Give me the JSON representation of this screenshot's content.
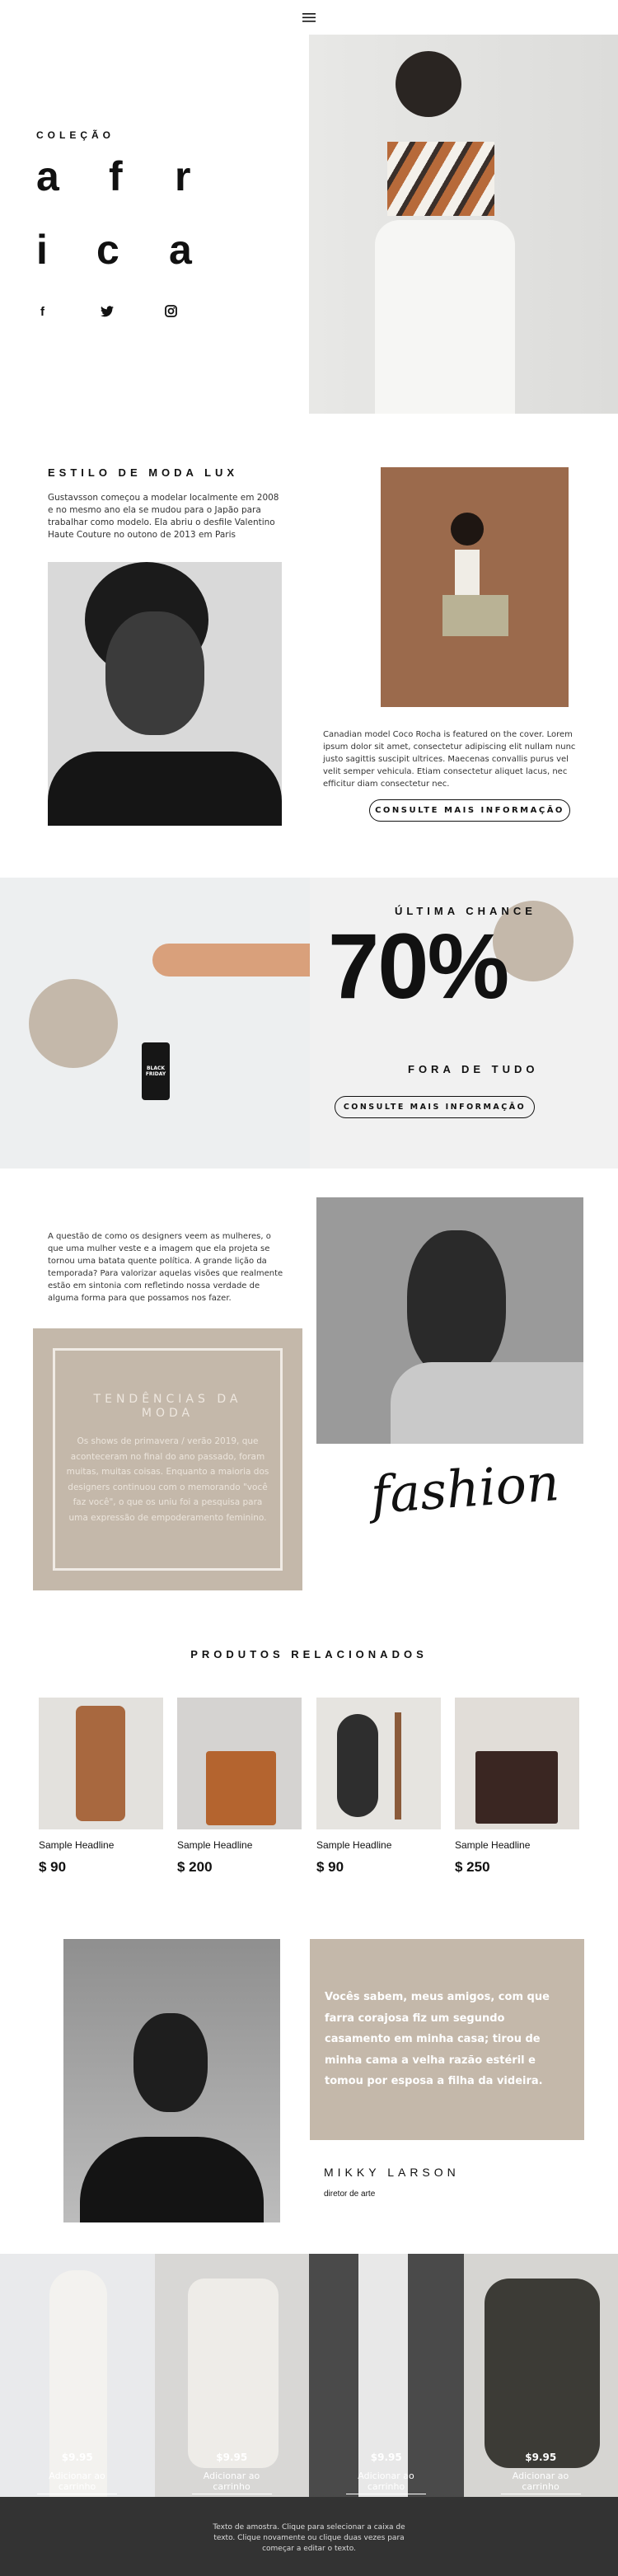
{
  "nav": {
    "menu_icon": "hamburger-icon"
  },
  "hero": {
    "kicker": "COLEÇÃO",
    "letters": [
      "a",
      "f",
      "r",
      "i",
      "c",
      "a"
    ],
    "social": [
      "facebook-icon",
      "twitter-icon",
      "instagram-icon"
    ]
  },
  "lux": {
    "title": "ESTILO DE MODA LUX",
    "text": "Gustavsson começou a modelar localmente em 2008 e no mesmo ano ela se mudou para o Japão para trabalhar como modelo. Ela abriu o desfile Valentino Haute Couture no outono de 2013 em Paris",
    "text2": "Canadian model Coco Rocha is featured on the cover. Lorem ipsum dolor sit amet, consectetur adipiscing elit nullam nunc justo sagittis suscipit ultrices. Maecenas convallis purus vel velit semper vehicula. Etiam consectetur aliquet lacus, nec efficitur diam consectetur nec.",
    "button": "CONSULTE MAIS INFORMAÇÃO"
  },
  "sale": {
    "kicker": "ÚLTIMA CHANCE",
    "percent": "70%",
    "sub": "FORA DE TUDO",
    "button": "CONSULTE MAIS INFORMAÇÃO",
    "tag_text": "BLACK FRIDAY"
  },
  "trends": {
    "text": "A questão de como os designers veem as mulheres, o que uma mulher veste e a imagem que ela projeta se tornou uma batata quente política. A grande lição da temporada? Para valorizar aquelas visões que realmente estão em sintonia com refletindo nossa verdade de alguma forma para que possamos nos fazer.",
    "box_title": "TENDÊNCIAS DA MODA",
    "box_text": "Os shows de primavera / verão 2019, que aconteceram no final do ano passado, foram muitas, muitas coisas. Enquanto a maioria dos designers continuou com o memorando \"você faz você\", o que os uniu foi a pesquisa para uma expressão de empoderamento feminino.",
    "script": "fashion"
  },
  "products": {
    "title": "PRODUTOS RELACIONADOS",
    "items": [
      {
        "name": "Sample Headline",
        "price": "$ 90"
      },
      {
        "name": "Sample Headline",
        "price": "$ 200"
      },
      {
        "name": "Sample Headline",
        "price": "$ 90"
      },
      {
        "name": "Sample Headline",
        "price": "$ 250"
      }
    ]
  },
  "quote": {
    "text": "Vocês sabem, meus amigos, com que farra corajosa fiz um segundo casamento em minha casa; tirou de minha cama a velha razão estéril e tomou por esposa a filha da videira.",
    "name": "MIKKY LARSON",
    "role": "diretor de arte"
  },
  "shop": {
    "items": [
      {
        "price": "$9.95",
        "button": "Adicionar ao carrinho"
      },
      {
        "price": "$9.95",
        "button": "Adicionar ao carrinho"
      },
      {
        "price": "$9.95",
        "button": "Adicionar ao carrinho"
      },
      {
        "price": "$9.95",
        "button": "Adicionar ao carrinho"
      }
    ]
  },
  "footer": {
    "text": "Texto de amostra. Clique para selecionar a caixa de texto. Clique novamente ou clique duas vezes para começar a editar o texto."
  },
  "colors": {
    "beige": "#c4b8aa",
    "footer": "#333333",
    "panel": "#f1f1f1"
  }
}
